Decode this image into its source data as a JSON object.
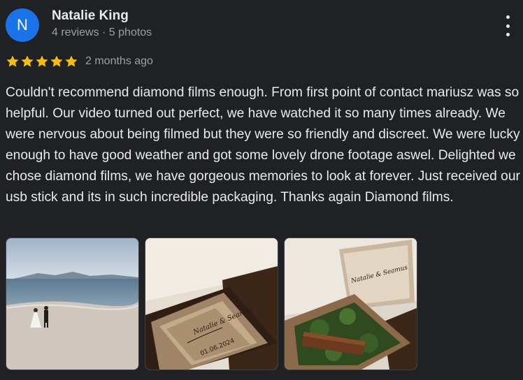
{
  "reviewer": {
    "initial": "N",
    "name": "Natalie King",
    "meta": "4 reviews · 5 photos",
    "avatar_color": "#1a73e8"
  },
  "rating": {
    "stars": 5,
    "max": 5,
    "star_color": "#fbbc04"
  },
  "time": "2 months ago",
  "review_text": "Couldn't recommend diamond films enough. From first point of contact mariusz was so helpful. Our video turned out perfect, we have watched it so many times already. We were nervous about being filmed but they were so friendly and discreet. We were lucky enough to have good weather and got some lovely drone footage aswel. Delighted we chose diamond films, we have gorgeous memories to look at forever. Just received our usb stick and its in such incredible packaging. Thanks again Diamond films.",
  "photos": [
    {
      "icon": "beach-couple-photo"
    },
    {
      "icon": "wooden-box-photo",
      "engraving": {
        "names": "Natalie & Seamus",
        "date": "01.06.2024"
      }
    },
    {
      "icon": "open-box-usb-photo",
      "engraving": {
        "names": "Natalie & Seamus"
      }
    }
  ],
  "menu_icon": "more-vert-icon"
}
